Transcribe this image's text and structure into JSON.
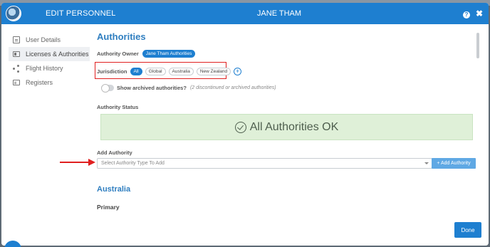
{
  "header": {
    "left_title": "EDIT PERSONNEL",
    "center_title": "JANE THAM",
    "help_glyph": "?",
    "close_glyph": "✖"
  },
  "sidebar": {
    "items": [
      {
        "label": "User Details",
        "icon": "user-details-icon"
      },
      {
        "label": "Licenses & Authorities",
        "icon": "id-card-icon",
        "active": true
      },
      {
        "label": "Flight History",
        "icon": "share-icon"
      },
      {
        "label": "Registers",
        "icon": "register-icon"
      }
    ]
  },
  "main": {
    "title": "Authorities",
    "owner_label": "Authority Owner",
    "owner_value": "Jane Tham Authorities",
    "jurisdiction_label": "Jurisdiction",
    "jurisdiction_chips": [
      "All",
      "Global",
      "Australia",
      "New Zealand"
    ],
    "jurisdiction_active": "All",
    "add_jurisdiction_glyph": "+",
    "archived_toggle_label": "Show archived authorities?",
    "archived_hint": "(2 discontinued or archived authorities)",
    "status_label": "Authority Status",
    "status_banner": "All Authorities OK",
    "add_authority_label": "Add Authority",
    "select_placeholder": "Select Authority Type To Add",
    "add_button_label": "+ Add Authority",
    "section_title": "Australia",
    "sub_title": "Primary"
  },
  "footer": {
    "done_label": "Done"
  },
  "colors": {
    "primary": "#1e7fd0",
    "highlight_box": "#e02020",
    "success_bg": "#dff0d8"
  }
}
